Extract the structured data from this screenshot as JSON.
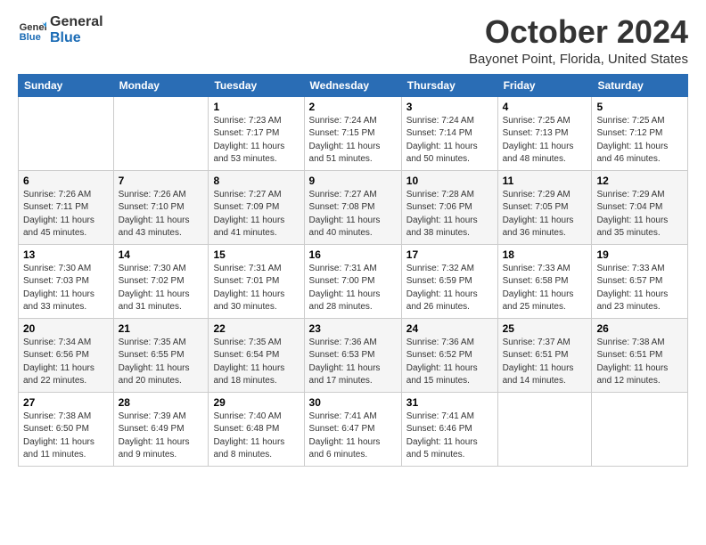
{
  "header": {
    "logo_line1": "General",
    "logo_line2": "Blue",
    "month": "October 2024",
    "location": "Bayonet Point, Florida, United States"
  },
  "days_of_week": [
    "Sunday",
    "Monday",
    "Tuesday",
    "Wednesday",
    "Thursday",
    "Friday",
    "Saturday"
  ],
  "weeks": [
    [
      {
        "day": "",
        "info": ""
      },
      {
        "day": "",
        "info": ""
      },
      {
        "day": "1",
        "info": "Sunrise: 7:23 AM\nSunset: 7:17 PM\nDaylight: 11 hours\nand 53 minutes."
      },
      {
        "day": "2",
        "info": "Sunrise: 7:24 AM\nSunset: 7:15 PM\nDaylight: 11 hours\nand 51 minutes."
      },
      {
        "day": "3",
        "info": "Sunrise: 7:24 AM\nSunset: 7:14 PM\nDaylight: 11 hours\nand 50 minutes."
      },
      {
        "day": "4",
        "info": "Sunrise: 7:25 AM\nSunset: 7:13 PM\nDaylight: 11 hours\nand 48 minutes."
      },
      {
        "day": "5",
        "info": "Sunrise: 7:25 AM\nSunset: 7:12 PM\nDaylight: 11 hours\nand 46 minutes."
      }
    ],
    [
      {
        "day": "6",
        "info": "Sunrise: 7:26 AM\nSunset: 7:11 PM\nDaylight: 11 hours\nand 45 minutes."
      },
      {
        "day": "7",
        "info": "Sunrise: 7:26 AM\nSunset: 7:10 PM\nDaylight: 11 hours\nand 43 minutes."
      },
      {
        "day": "8",
        "info": "Sunrise: 7:27 AM\nSunset: 7:09 PM\nDaylight: 11 hours\nand 41 minutes."
      },
      {
        "day": "9",
        "info": "Sunrise: 7:27 AM\nSunset: 7:08 PM\nDaylight: 11 hours\nand 40 minutes."
      },
      {
        "day": "10",
        "info": "Sunrise: 7:28 AM\nSunset: 7:06 PM\nDaylight: 11 hours\nand 38 minutes."
      },
      {
        "day": "11",
        "info": "Sunrise: 7:29 AM\nSunset: 7:05 PM\nDaylight: 11 hours\nand 36 minutes."
      },
      {
        "day": "12",
        "info": "Sunrise: 7:29 AM\nSunset: 7:04 PM\nDaylight: 11 hours\nand 35 minutes."
      }
    ],
    [
      {
        "day": "13",
        "info": "Sunrise: 7:30 AM\nSunset: 7:03 PM\nDaylight: 11 hours\nand 33 minutes."
      },
      {
        "day": "14",
        "info": "Sunrise: 7:30 AM\nSunset: 7:02 PM\nDaylight: 11 hours\nand 31 minutes."
      },
      {
        "day": "15",
        "info": "Sunrise: 7:31 AM\nSunset: 7:01 PM\nDaylight: 11 hours\nand 30 minutes."
      },
      {
        "day": "16",
        "info": "Sunrise: 7:31 AM\nSunset: 7:00 PM\nDaylight: 11 hours\nand 28 minutes."
      },
      {
        "day": "17",
        "info": "Sunrise: 7:32 AM\nSunset: 6:59 PM\nDaylight: 11 hours\nand 26 minutes."
      },
      {
        "day": "18",
        "info": "Sunrise: 7:33 AM\nSunset: 6:58 PM\nDaylight: 11 hours\nand 25 minutes."
      },
      {
        "day": "19",
        "info": "Sunrise: 7:33 AM\nSunset: 6:57 PM\nDaylight: 11 hours\nand 23 minutes."
      }
    ],
    [
      {
        "day": "20",
        "info": "Sunrise: 7:34 AM\nSunset: 6:56 PM\nDaylight: 11 hours\nand 22 minutes."
      },
      {
        "day": "21",
        "info": "Sunrise: 7:35 AM\nSunset: 6:55 PM\nDaylight: 11 hours\nand 20 minutes."
      },
      {
        "day": "22",
        "info": "Sunrise: 7:35 AM\nSunset: 6:54 PM\nDaylight: 11 hours\nand 18 minutes."
      },
      {
        "day": "23",
        "info": "Sunrise: 7:36 AM\nSunset: 6:53 PM\nDaylight: 11 hours\nand 17 minutes."
      },
      {
        "day": "24",
        "info": "Sunrise: 7:36 AM\nSunset: 6:52 PM\nDaylight: 11 hours\nand 15 minutes."
      },
      {
        "day": "25",
        "info": "Sunrise: 7:37 AM\nSunset: 6:51 PM\nDaylight: 11 hours\nand 14 minutes."
      },
      {
        "day": "26",
        "info": "Sunrise: 7:38 AM\nSunset: 6:51 PM\nDaylight: 11 hours\nand 12 minutes."
      }
    ],
    [
      {
        "day": "27",
        "info": "Sunrise: 7:38 AM\nSunset: 6:50 PM\nDaylight: 11 hours\nand 11 minutes."
      },
      {
        "day": "28",
        "info": "Sunrise: 7:39 AM\nSunset: 6:49 PM\nDaylight: 11 hours\nand 9 minutes."
      },
      {
        "day": "29",
        "info": "Sunrise: 7:40 AM\nSunset: 6:48 PM\nDaylight: 11 hours\nand 8 minutes."
      },
      {
        "day": "30",
        "info": "Sunrise: 7:41 AM\nSunset: 6:47 PM\nDaylight: 11 hours\nand 6 minutes."
      },
      {
        "day": "31",
        "info": "Sunrise: 7:41 AM\nSunset: 6:46 PM\nDaylight: 11 hours\nand 5 minutes."
      },
      {
        "day": "",
        "info": ""
      },
      {
        "day": "",
        "info": ""
      }
    ]
  ]
}
